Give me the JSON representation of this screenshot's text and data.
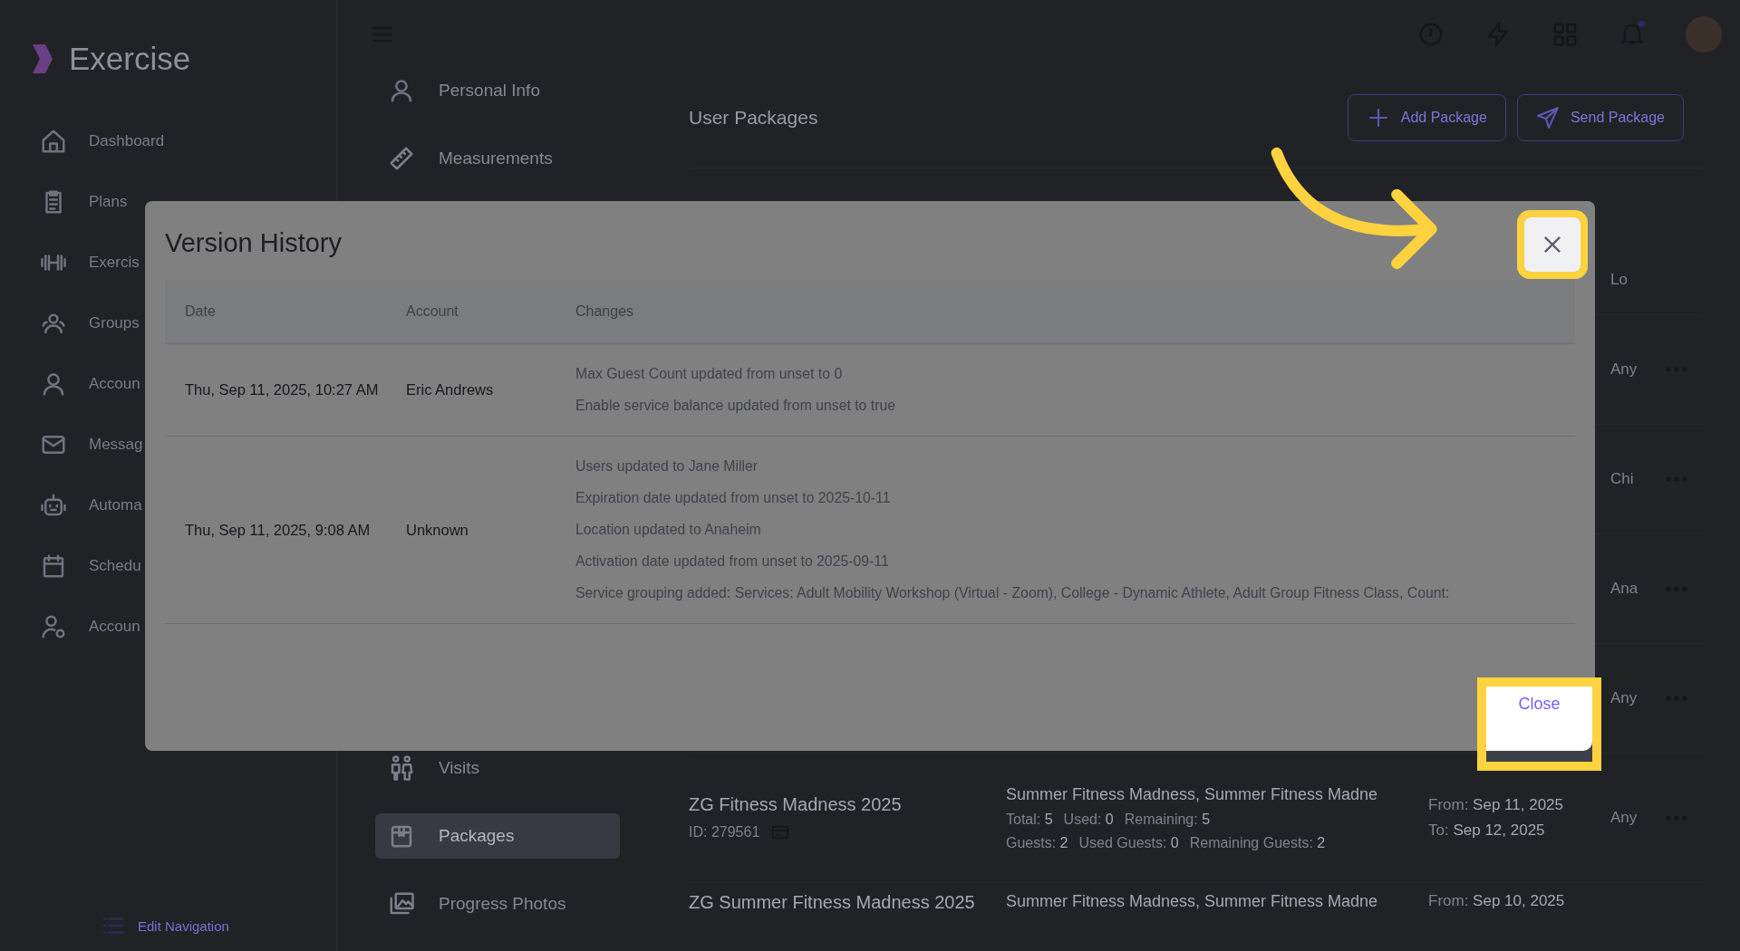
{
  "app": {
    "logo_text": "Exercise",
    "sidebar": {
      "items": [
        {
          "label": "Dashboard"
        },
        {
          "label": "Plans"
        },
        {
          "label": "Exercis"
        },
        {
          "label": "Groups"
        },
        {
          "label": "Accoun"
        },
        {
          "label": "Messag"
        },
        {
          "label": "Automa"
        },
        {
          "label": "Schedu"
        },
        {
          "label": "Accoun"
        }
      ],
      "edit_navigation": "Edit Navigation"
    }
  },
  "profile_nav": {
    "top_items": [
      {
        "label": "Personal Info",
        "selected": false
      },
      {
        "label": "Measurements",
        "selected": false
      }
    ],
    "bottom_items": [
      {
        "label": "Visits",
        "selected": false
      },
      {
        "label": "Packages",
        "selected": true
      },
      {
        "label": "Progress Photos",
        "selected": false
      }
    ]
  },
  "main": {
    "title": "User Packages",
    "buttons": [
      {
        "label": "Add Package",
        "kind": "add"
      },
      {
        "label": "Send Package",
        "kind": "send"
      }
    ],
    "table": {
      "column_5_header": "Lo",
      "rows": [
        {
          "column_5": "Any"
        },
        {
          "column_5": "Chi"
        },
        {
          "column_5": "Ana"
        },
        {
          "column_5": "Any"
        },
        {
          "name": "ZG Fitness Madness 2025",
          "id": "ID: 279561",
          "packages": "Summer Fitness Madness, Summer Fitness Madne",
          "counts": [
            {
              "label": "Total:",
              "value": "5"
            },
            {
              "label": "Used:",
              "value": "0"
            },
            {
              "label": "Remaining:",
              "value": "5"
            }
          ],
          "guest_counts": [
            {
              "label": "Guests:",
              "value": "2"
            },
            {
              "label": "Used Guests:",
              "value": "0"
            },
            {
              "label": "Remaining Guests:",
              "value": "2"
            }
          ],
          "dates": [
            {
              "label": "From:",
              "value": "Sep 11, 2025"
            },
            {
              "label": "To:",
              "value": "Sep 12, 2025"
            }
          ],
          "column_5": "Any"
        },
        {
          "name": "ZG Summer Fitness Madness 2025",
          "packages": "Summer Fitness Madness, Summer Fitness Madne",
          "dates": [
            {
              "label": "From:",
              "value": "Sep 10, 2025"
            }
          ]
        }
      ]
    }
  },
  "modal": {
    "title": "Version History",
    "columns": [
      "Date",
      "Account",
      "Changes"
    ],
    "rows": [
      {
        "date": "Thu, Sep 11, 2025, 10:27 AM",
        "account": "Eric Andrews",
        "changes": [
          "Max Guest Count updated from unset to 0",
          "Enable service balance updated from unset to true"
        ]
      },
      {
        "date": "Thu, Sep 11, 2025, 9:08 AM",
        "account": "Unknown",
        "changes": [
          "Users updated to Jane Miller",
          "Expiration date updated from unset to 2025-10-11",
          "Location updated to Anaheim",
          "Activation date updated from unset to 2025-09-11",
          "Service grouping added: Services: Adult Mobility Workshop (Virtual - Zoom), College - Dynamic Athlete, Adult Group Fitness Class, Count:"
        ]
      }
    ],
    "close_label": "Close"
  }
}
